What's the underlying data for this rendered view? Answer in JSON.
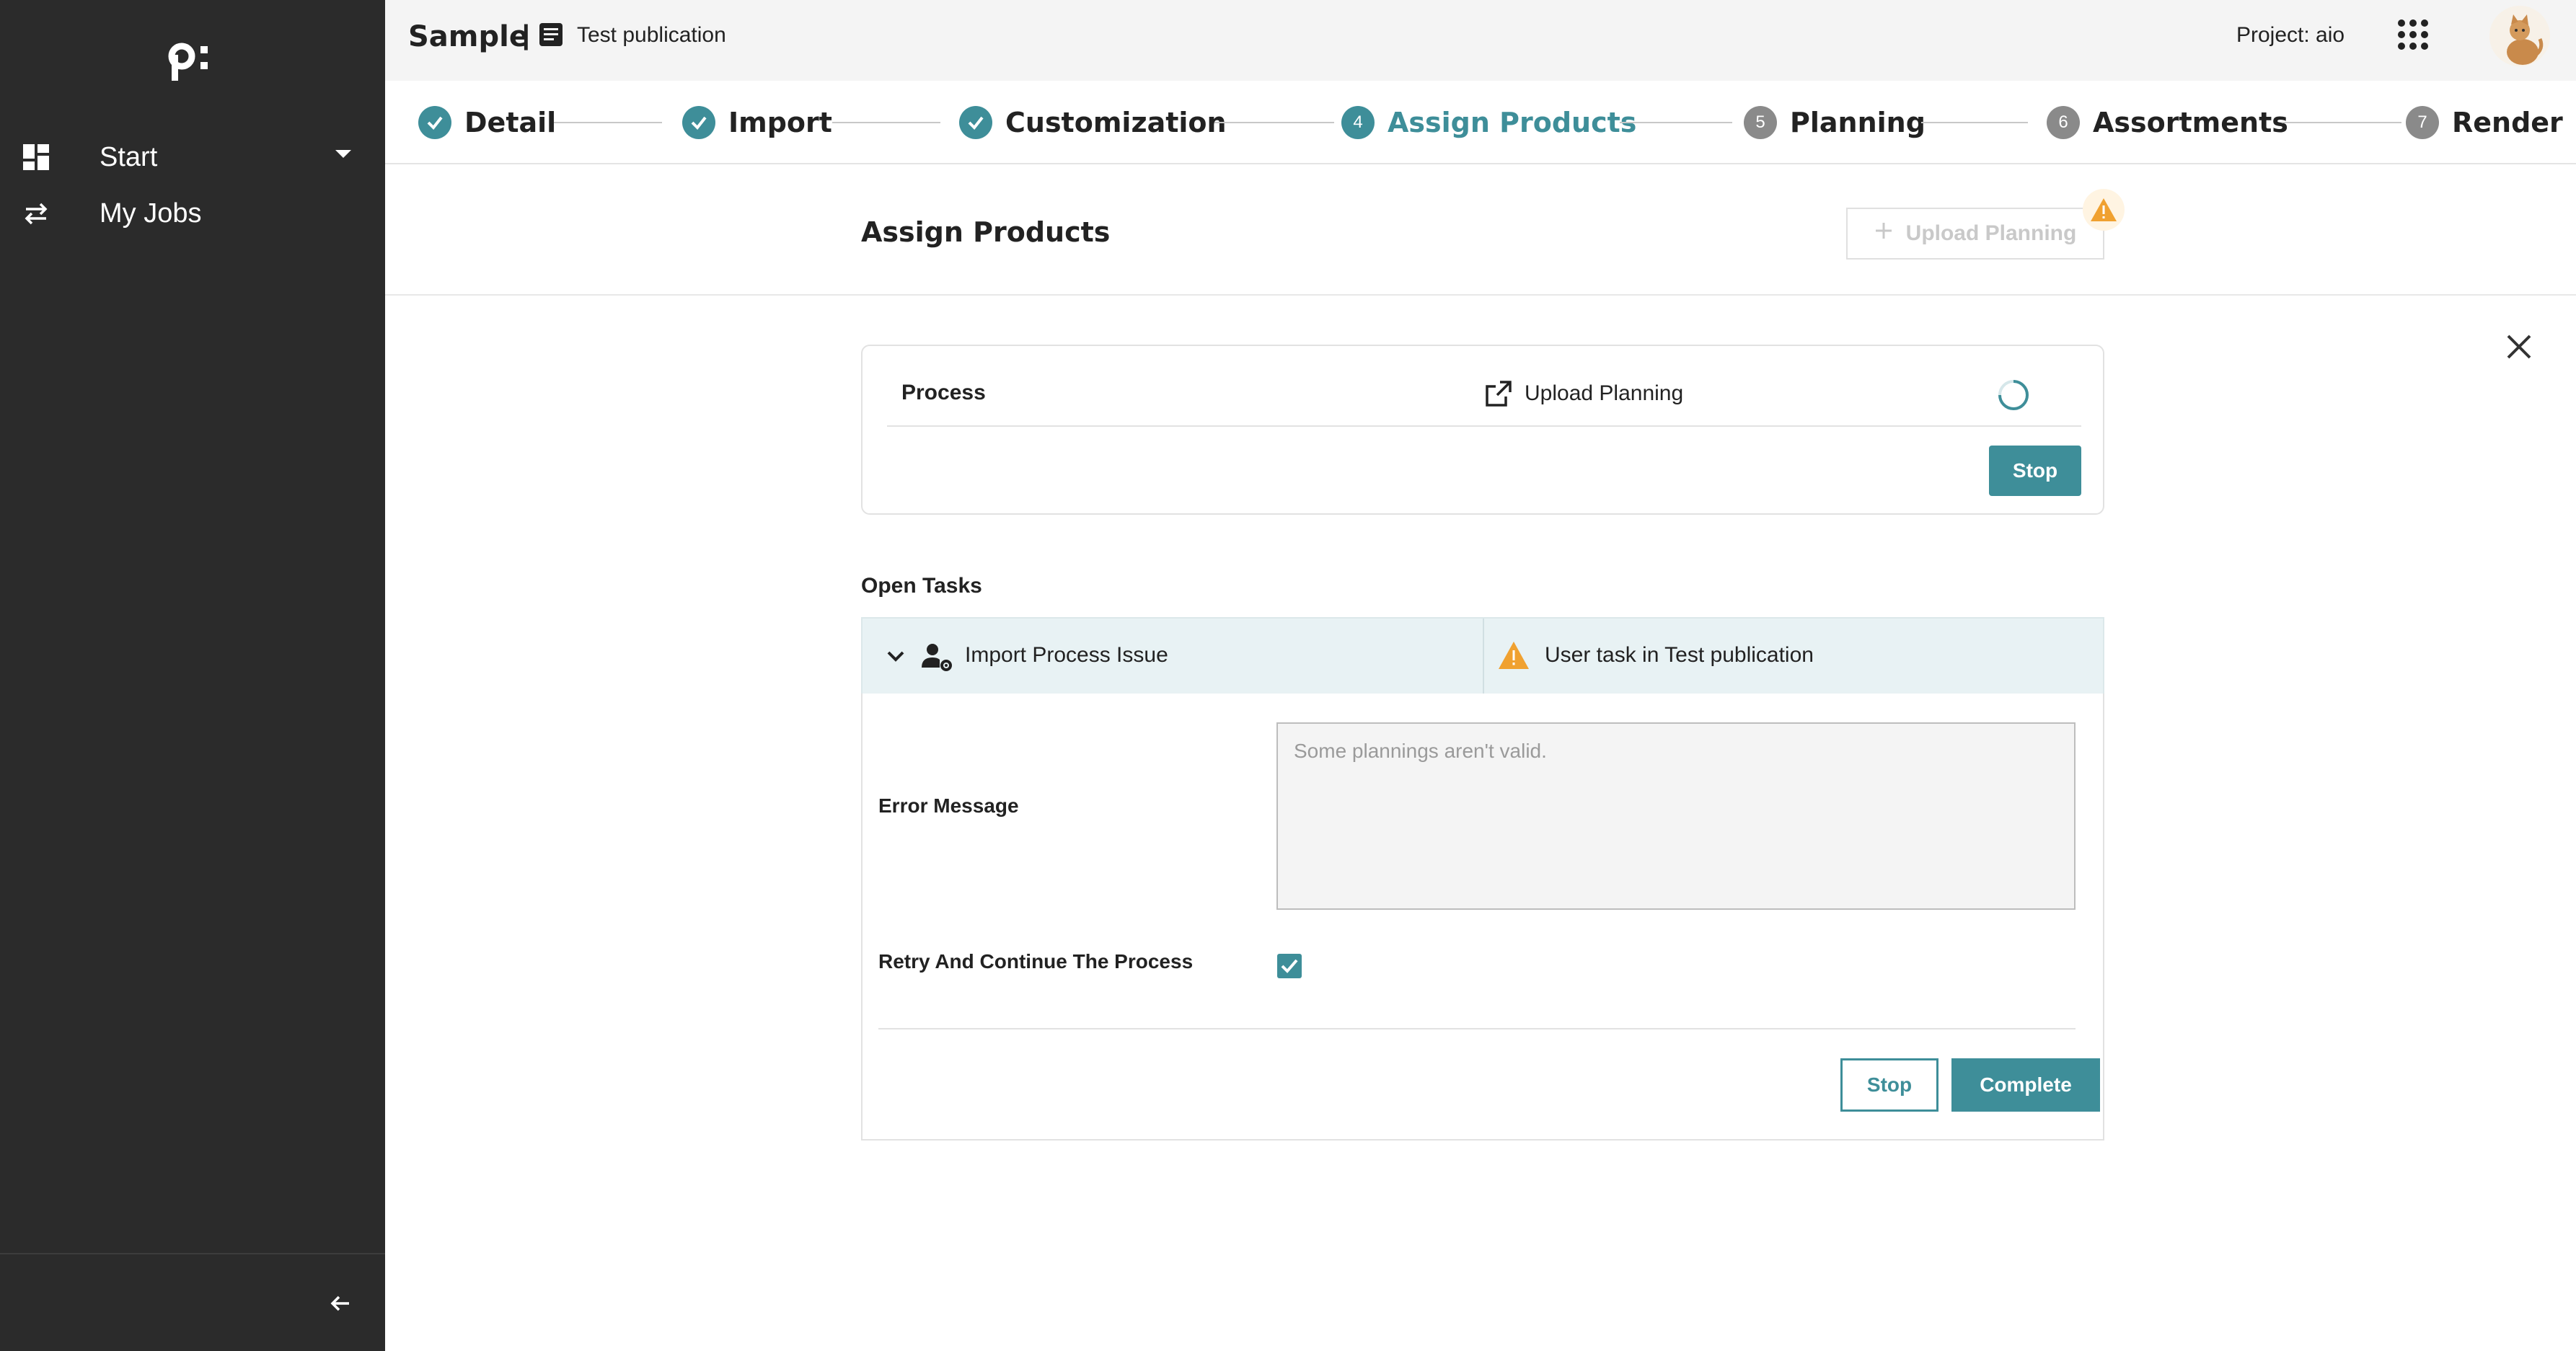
{
  "sidebar": {
    "items": [
      {
        "label": "Start",
        "icon": "dashboard-icon"
      },
      {
        "label": "My Jobs",
        "icon": "jobs-icon"
      }
    ]
  },
  "header": {
    "app_title": "Sample",
    "separator": "|",
    "publication": "Test publication",
    "project": "Project: aio"
  },
  "stepper": {
    "steps": [
      {
        "number": "1",
        "label": "Detail",
        "state": "done"
      },
      {
        "number": "2",
        "label": "Import",
        "state": "done"
      },
      {
        "number": "3",
        "label": "Customization",
        "state": "done"
      },
      {
        "number": "4",
        "label": "Assign Products",
        "state": "active"
      },
      {
        "number": "5",
        "label": "Planning",
        "state": "todo"
      },
      {
        "number": "6",
        "label": "Assortments",
        "state": "todo"
      },
      {
        "number": "7",
        "label": "Render",
        "state": "todo"
      }
    ]
  },
  "page": {
    "title": "Assign Products",
    "upload_button": "Upload Planning"
  },
  "process": {
    "label": "Process",
    "link": "Upload Planning",
    "stop_button": "Stop"
  },
  "tasks": {
    "heading": "Open Tasks",
    "task": {
      "title": "Import Process Issue",
      "subtitle": "User task in Test publication",
      "error_label": "Error Message",
      "error_placeholder": "Some plannings aren't valid.",
      "retry_label": "Retry And Continue The Process",
      "retry_checked": true,
      "stop_button": "Stop",
      "complete_button": "Complete"
    }
  },
  "colors": {
    "accent": "#3e8e99",
    "sidebar": "#2b2b2b",
    "warning": "#f0a130"
  }
}
